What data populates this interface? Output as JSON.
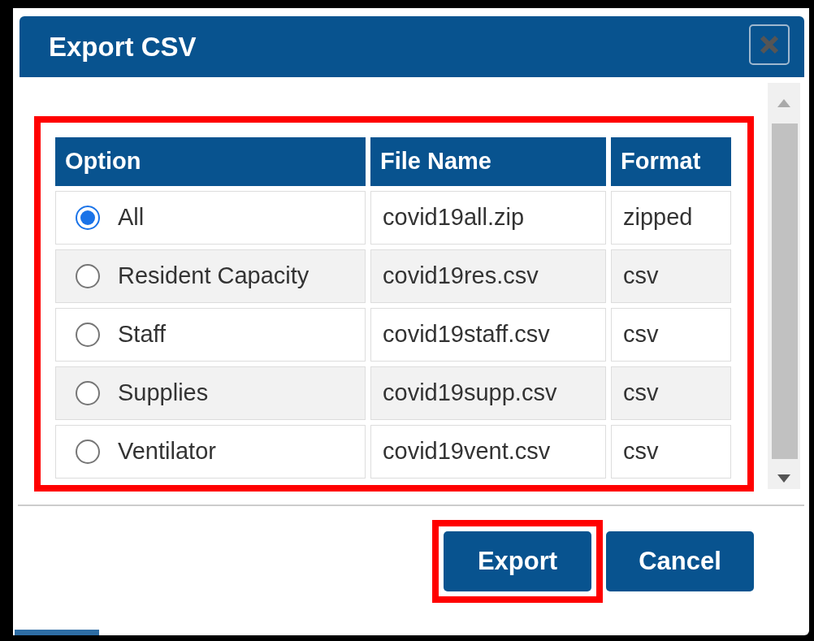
{
  "dialog": {
    "title": "Export CSV"
  },
  "table": {
    "highlighted": true,
    "columns": [
      "Option",
      "File Name",
      "Format"
    ],
    "rows": [
      {
        "option": "All",
        "selected": true,
        "file_name": "covid19all.zip",
        "format": "zipped"
      },
      {
        "option": "Resident Capacity",
        "selected": false,
        "file_name": "covid19res.csv",
        "format": "csv"
      },
      {
        "option": "Staff",
        "selected": false,
        "file_name": "covid19staff.csv",
        "format": "csv"
      },
      {
        "option": "Supplies",
        "selected": false,
        "file_name": "covid19supp.csv",
        "format": "csv"
      },
      {
        "option": "Ventilator",
        "selected": false,
        "file_name": "covid19vent.csv",
        "format": "csv"
      }
    ]
  },
  "buttons": [
    {
      "label": "Export",
      "highlighted": true
    },
    {
      "label": "Cancel",
      "highlighted": false
    }
  ]
}
